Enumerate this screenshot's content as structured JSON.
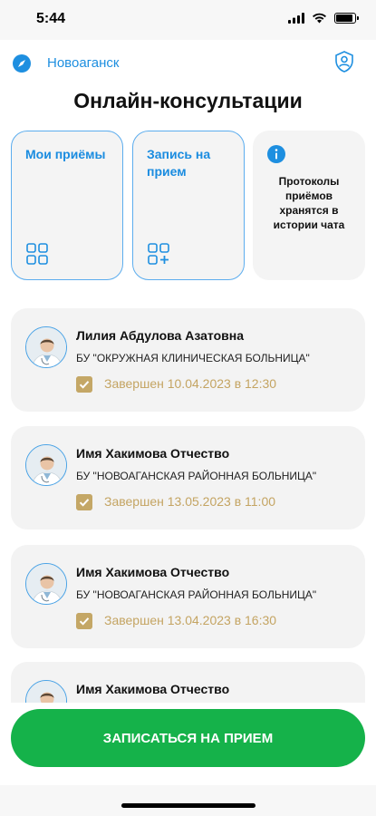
{
  "status_bar": {
    "time": "5:44",
    "battery_level": 0.9
  },
  "header": {
    "city": "Новоаганск",
    "location_icon": "compass-icon",
    "profile_icon": "user-shield-icon"
  },
  "page_title": "Онлайн-консультации",
  "tiles": [
    {
      "label": "Мои приёмы",
      "icon": "grid-icon"
    },
    {
      "label": "Запись на прием",
      "icon": "grid-add-icon"
    },
    {
      "text": "Протоколы приёмов хранятся в истории чата",
      "icon": "info-icon"
    }
  ],
  "appointments": [
    {
      "doctor": "Лилия Абдулова Азатовна",
      "hospital": "БУ \"ОКРУЖНАЯ КЛИНИЧЕСКАЯ БОЛЬНИЦА\"",
      "status": "Завершен 10.04.2023 в 12:30"
    },
    {
      "doctor": "Имя Хакимова Отчество",
      "hospital": "БУ \"НОВОАГАНСКАЯ РАЙОННАЯ БОЛЬНИЦА\"",
      "status": "Завершен 13.05.2023 в 11:00"
    },
    {
      "doctor": "Имя Хакимова Отчество",
      "hospital": "БУ \"НОВОАГАНСКАЯ РАЙОННАЯ БОЛЬНИЦА\"",
      "status": "Завершен 13.04.2023 в 16:30"
    },
    {
      "doctor": "Имя Хакимова Отчество",
      "hospital": "",
      "status": ""
    }
  ],
  "book_button": {
    "label": "ЗАПИСАТЬСЯ НА ПРИЕМ"
  },
  "colors": {
    "accent": "#1e8fe0",
    "primary_button": "#15b24a",
    "status_gold": "#c4a462",
    "card_bg": "#f3f3f3"
  }
}
